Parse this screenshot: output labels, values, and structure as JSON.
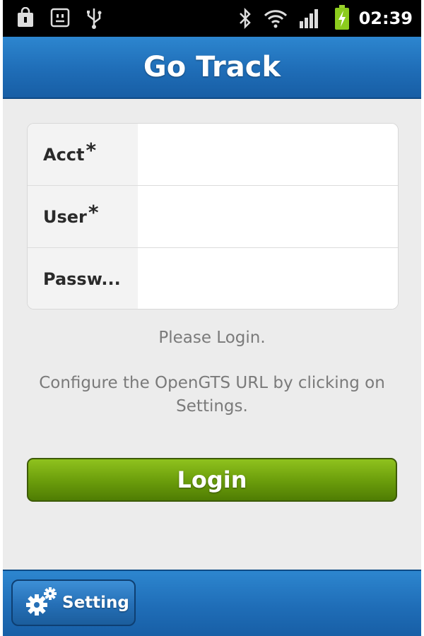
{
  "status_bar": {
    "time": "02:39",
    "icons": [
      "shopping-bag-icon",
      "android-face-icon",
      "usb-icon",
      "bluetooth-icon",
      "wifi-icon",
      "signal-icon",
      "battery-charging-icon"
    ]
  },
  "app": {
    "title": "Go Track"
  },
  "form": {
    "fields": [
      {
        "label": "Acct",
        "required_mark": "*",
        "value": ""
      },
      {
        "label": "User",
        "required_mark": "*",
        "value": ""
      },
      {
        "label": "Passw...",
        "required_mark": "",
        "value": ""
      }
    ]
  },
  "messages": {
    "login_prompt": "Please Login.",
    "config_hint": "Configure the OpenGTS URL by clicking on Settings."
  },
  "buttons": {
    "login": "Login",
    "setting": "Setting"
  },
  "colors": {
    "title_bar": "#1f6db7",
    "login_button": "#6d9f0c",
    "background": "#ececec"
  }
}
